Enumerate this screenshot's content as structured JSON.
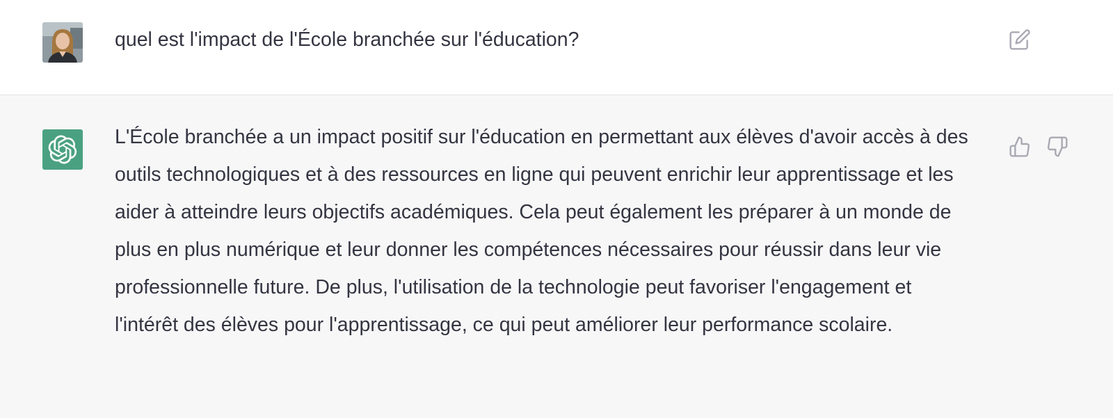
{
  "conversation": {
    "user_message": {
      "avatar": "user-photo-avatar",
      "text": "quel est l'impact de l'École branchée sur l'éducation?",
      "edit_icon": "edit-icon"
    },
    "assistant_message": {
      "avatar": "openai-logo",
      "text": "L'École branchée a un impact positif sur l'éducation en permettant aux élèves d'avoir accès à des outils technologiques et à des ressources en ligne qui peuvent enrichir leur apprentissage et les aider à atteindre leurs objectifs académiques. Cela peut également les préparer à un monde de plus en plus numérique et leur donner les compétences nécessaires pour réussir dans leur vie professionnelle future. De plus, l'utilisation de la technologie peut favoriser l'engagement et l'intérêt des élèves pour l'apprentissage, ce qui peut améliorer leur performance scolaire.",
      "feedback_icons": [
        "thumbs-up-icon",
        "thumbs-down-icon"
      ]
    }
  },
  "colors": {
    "assistant_bg": "#f7f7f8",
    "assistant_avatar_bg": "#4aa181",
    "text": "#343541",
    "icon": "#a9a9b3"
  }
}
